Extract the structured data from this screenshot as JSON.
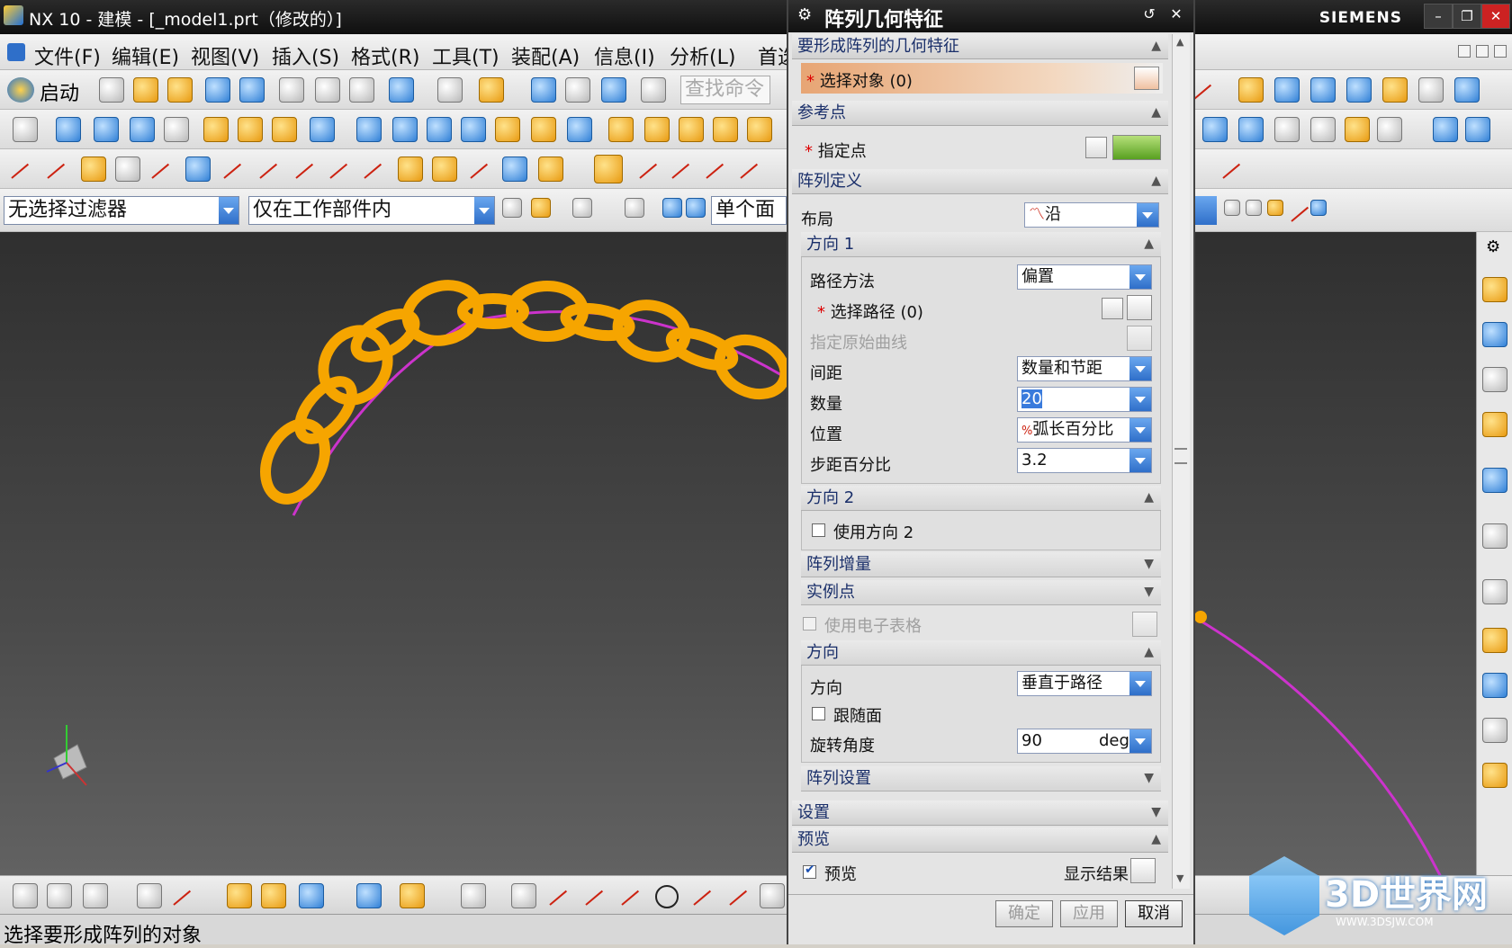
{
  "window": {
    "title": "NX 10 - 建模 - [_model1.prt（修改的）]",
    "brand": "SIEMENS"
  },
  "menu": [
    "文件(F)",
    "编辑(E)",
    "视图(V)",
    "插入(S)",
    "格式(R)",
    "工具(T)",
    "装配(A)",
    "信息(I)",
    "分析(L)",
    "首选"
  ],
  "toolbar": {
    "start_label": "启动",
    "search_placeholder": "查找命令"
  },
  "filters": {
    "selection_filter": "无选择过滤器",
    "scope": "仅在工作部件内",
    "face_rule": "单个面"
  },
  "dialog": {
    "title": "阵列几何特征",
    "sections": {
      "geometry": "要形成阵列的几何特征",
      "select_object": "选择对象 (0)",
      "reference_point": "参考点",
      "specify_point": "指定点",
      "pattern_definition": "阵列定义",
      "layout_label": "布局",
      "layout_value": "沿",
      "direction1": "方向 1",
      "path_method_label": "路径方法",
      "path_method_value": "偏置",
      "select_path": "选择路径 (0)",
      "specify_original_curve": "指定原始曲线",
      "spacing_label": "间距",
      "spacing_value": "数量和节距",
      "count_label": "数量",
      "count_value": "20",
      "position_label": "位置",
      "position_value": "弧长百分比",
      "step_percent_label": "步距百分比",
      "step_percent_value": "3.2",
      "direction2": "方向 2",
      "use_direction2": "使用方向 2",
      "pattern_increment": "阵列增量",
      "instance_points": "实例点",
      "use_spreadsheet": "使用电子表格",
      "orientation": "方向",
      "orientation_label": "方向",
      "orientation_value": "垂直于路径",
      "follow_face": "跟随面",
      "rotation_angle_label": "旋转角度",
      "rotation_angle_value": "90",
      "rotation_angle_unit": "deg",
      "pattern_settings": "阵列设置",
      "settings": "设置",
      "preview_section": "预览",
      "preview_check": "预览",
      "show_result": "显示结果"
    },
    "buttons": {
      "ok": "确定",
      "apply": "应用",
      "cancel": "取消"
    },
    "states": {
      "use_direction2": false,
      "use_spreadsheet": false,
      "follow_face": false,
      "preview": true
    }
  },
  "status": "选择要形成阵列的对象",
  "watermark": {
    "brand": "3D世界网",
    "url": "WWW.3DSJW.COM"
  },
  "colors": {
    "chain": "#f6a500",
    "path": "#cc33cc",
    "highlight_row": "#e8b88a"
  }
}
